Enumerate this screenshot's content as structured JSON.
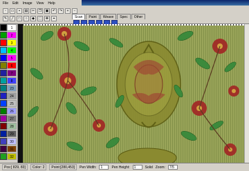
{
  "menu": [
    "File",
    "Edit",
    "Image",
    "View",
    "Help"
  ],
  "tabs": [
    "Scan",
    "Paint",
    "Weave",
    "Spec",
    "Other"
  ],
  "palette": {
    "numbers": [
      "1",
      "2",
      "3",
      "4",
      "5",
      "6",
      "7",
      "8",
      "23",
      "24",
      "25",
      "26",
      "27",
      "28",
      "29",
      "30",
      "31",
      "32",
      "13",
      "14"
    ],
    "colors_left": [
      "#000000",
      "#00a000",
      "#ff0000",
      "#00c0ff",
      "#0000ff",
      "#808000",
      "#2020a0",
      "#00a0a0",
      "#008080",
      "#2020c0",
      "#0040ff",
      "#008000",
      "#a000a0",
      "#800000",
      "#0020a0",
      "#4040c0",
      "#400040",
      "#20a020",
      "#c0a000",
      "#a000a0"
    ],
    "colors_right": [
      "#ffffff",
      "#ff00ff",
      "#ffff00",
      "#00ff00",
      "#ff00ff",
      "#ff0000",
      "#800080",
      "#4040ff",
      "#80a0c0",
      "#a0a0a0",
      "#c0c0c0",
      "#a0a0ff",
      "#808080",
      "#a0c0a0",
      "#606060",
      "#c0c0ff",
      "#804000",
      "#c0c000",
      "#20a0a0",
      "#404080"
    ]
  },
  "status": {
    "pos": "Pos:[ 829,  83]",
    "color": "Color: 2",
    "point": "Point:[280,453]",
    "pen_width_label": "Pen Width:",
    "pen_width_value": "1",
    "pen_height_label": "Pen Height:",
    "pen_height_value": "1",
    "solid": "Solid",
    "zoom_label": "Zoom:",
    "zoom_value": "7/5"
  },
  "colors": {
    "leaf": "#3c8a3c",
    "petal": "#a03028",
    "ground": "#9aa55a",
    "large_flower": "#8a8a30"
  }
}
